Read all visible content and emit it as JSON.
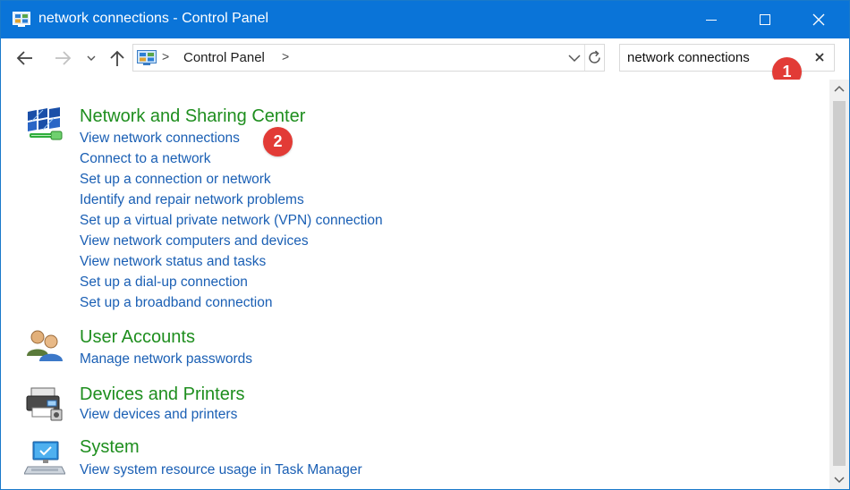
{
  "window": {
    "title": "network connections - Control Panel",
    "accent_color": "#0a74d8",
    "buttons": [
      "minimize-icon",
      "maximize-icon",
      "close-icon"
    ]
  },
  "nav": {
    "icons": [
      "back-arrow-icon",
      "forward-arrow-icon",
      "recent-locations-icon",
      "up-arrow-icon"
    ]
  },
  "address": {
    "icon": "control-panel-icon",
    "separator": ">",
    "crumb": "Control Panel",
    "trailing_separator": ">"
  },
  "search": {
    "value": "network connections",
    "clear_icon": "clear-x-icon"
  },
  "badges": {
    "one": "1",
    "two": "2",
    "color": "#e23b36"
  },
  "colors": {
    "category_title": "#1e8e1e",
    "link": "#1a5fb4"
  },
  "categories": [
    {
      "icon": "network-sharing-icon",
      "title": "Network and Sharing Center",
      "links": [
        "View network connections",
        "Connect to a network",
        "Set up a connection or network",
        "Identify and repair network problems",
        "Set up a virtual private network (VPN) connection",
        "View network computers and devices",
        "View network status and tasks",
        "Set up a dial-up connection",
        "Set up a broadband connection"
      ]
    },
    {
      "icon": "user-accounts-icon",
      "title": "User Accounts",
      "links": [
        "Manage network passwords"
      ]
    },
    {
      "icon": "devices-printers-icon",
      "title": "Devices and Printers",
      "links": [
        "View devices and printers"
      ]
    },
    {
      "icon": "system-icon",
      "title": "System",
      "links": [
        "View system resource usage in Task Manager"
      ]
    }
  ]
}
